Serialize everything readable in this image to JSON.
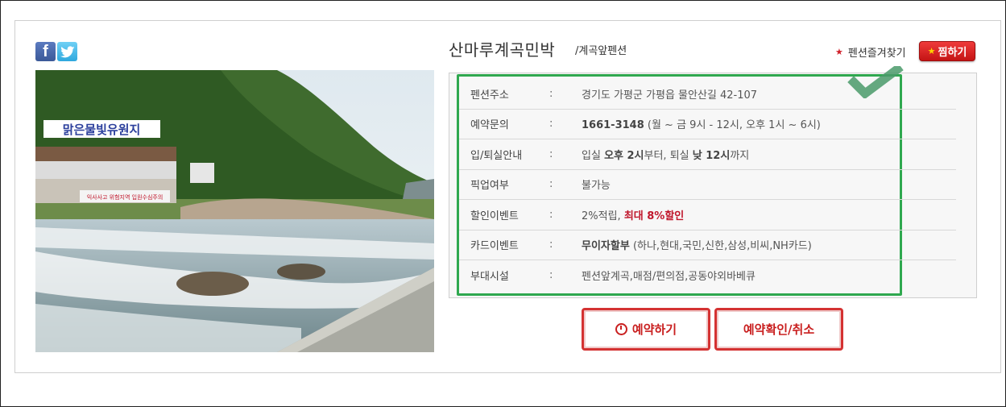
{
  "pension": {
    "name": "산마루계곡민박",
    "subtitle": "/계곡앞펜션"
  },
  "social": {
    "facebook_icon": "facebook-icon",
    "twitter_icon": "twitter-icon"
  },
  "favorites": {
    "label": "펜션즐겨찾기",
    "button_label": "찜하기"
  },
  "photo": {
    "sign_main": "맑은물빛유원지",
    "sign_sub": "익사사고 위험지역 입원수심주의"
  },
  "info": {
    "separator": ":",
    "rows": [
      {
        "label": "펜션주소",
        "value": "경기도 가평군 가평읍 물안산길 42-107"
      },
      {
        "label": "예약문의",
        "value_bold": "1661-3148",
        "value": " (월 ~ 금 9시 - 12시, 오후 1시 ~ 6시)"
      },
      {
        "label": "입/퇴실안내",
        "p1": "입실 ",
        "b1": "오후 2시",
        "p2": "부터, 퇴실 ",
        "b2": "낮 12시",
        "p3": "까지"
      },
      {
        "label": "픽업여부",
        "value": "불가능"
      },
      {
        "label": "할인이벤트",
        "value": "2%적립, ",
        "value_red": "최대 8%할인"
      },
      {
        "label": "카드이벤트",
        "value_bold": "무이자할부",
        "value": " (하나,현대,국민,신한,삼성,비씨,NH카드)"
      },
      {
        "label": "부대시설",
        "value": "펜션앞계곡,매점/편의점,공동야외바베큐"
      }
    ]
  },
  "buttons": {
    "reserve": "예약하기",
    "confirm_cancel": "예약확인/취소"
  },
  "colors": {
    "accent_red": "#c92020",
    "highlight_green": "#2fa84f"
  }
}
